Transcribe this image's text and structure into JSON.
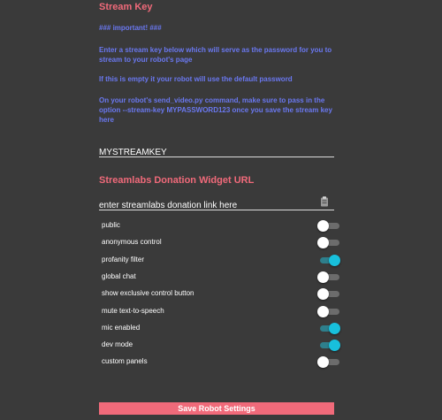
{
  "stream_key": {
    "title": "Stream Key",
    "important": "### important! ###",
    "info1": "Enter a stream key below which will serve as the password for you to stream to your robot's page",
    "info2": "If this is empty it your robot will use the default password",
    "info3": "On your robot's send_video.py command, make sure to pass in the option --stream-key MYPASSWORD123 once you save the stream key here",
    "value": "MYSTREAMKEY"
  },
  "donation": {
    "title": "Streamlabs Donation Widget URL",
    "placeholder": "enter streamlabs donation link here"
  },
  "settings": [
    {
      "label": "public",
      "on": false
    },
    {
      "label": "anonymous control",
      "on": false
    },
    {
      "label": "profanity filter",
      "on": true
    },
    {
      "label": "global chat",
      "on": false
    },
    {
      "label": "show exclusive control button",
      "on": false
    },
    {
      "label": "mute text-to-speech",
      "on": false
    },
    {
      "label": "mic enabled",
      "on": true
    },
    {
      "label": "dev mode",
      "on": true
    },
    {
      "label": "custom panels",
      "on": false
    }
  ],
  "save_label": "Save Robot Settings",
  "colors": {
    "background": "#3a3a3a",
    "title": "#f06a7a",
    "info": "#6a78f0",
    "toggle_on": "#18c0dc",
    "button": "#f06a7a"
  },
  "icons": {
    "clipboard": "clipboard-icon"
  }
}
